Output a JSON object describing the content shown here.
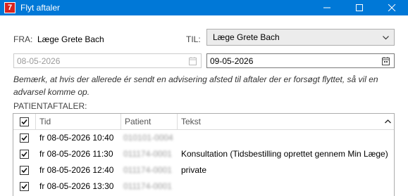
{
  "window": {
    "app_icon_text": "7",
    "title": "Flyt aftaler"
  },
  "from": {
    "label": "FRA:",
    "value": "Læge Grete Bach",
    "date": "08-05-2026"
  },
  "to": {
    "label": "TIL:",
    "value": "Læge Grete Bach",
    "date": "09-05-2026"
  },
  "note": "Bemærk, at hvis der allerede ér sendt en advisering afsted til aftaler der er forsøgt flyttet, så vil en advarsel komme op.",
  "appointments": {
    "label": "PATIENTAFTALER:",
    "columns": [
      "Tid",
      "Patient",
      "Tekst"
    ],
    "rows": [
      {
        "checked": true,
        "time": "fr 08-05-2026 10:40",
        "patient": "010101-0004",
        "text": ""
      },
      {
        "checked": true,
        "time": "fr 08-05-2026 11:30",
        "patient": "011174-0001",
        "text": "Konsultation (Tidsbestilling oprettet gennem Min Læge)"
      },
      {
        "checked": true,
        "time": "fr 08-05-2026 12:40",
        "patient": "011174-0001",
        "text": "private"
      },
      {
        "checked": true,
        "time": "fr 08-05-2026 13:30",
        "patient": "011174-0001",
        "text": ""
      }
    ]
  }
}
